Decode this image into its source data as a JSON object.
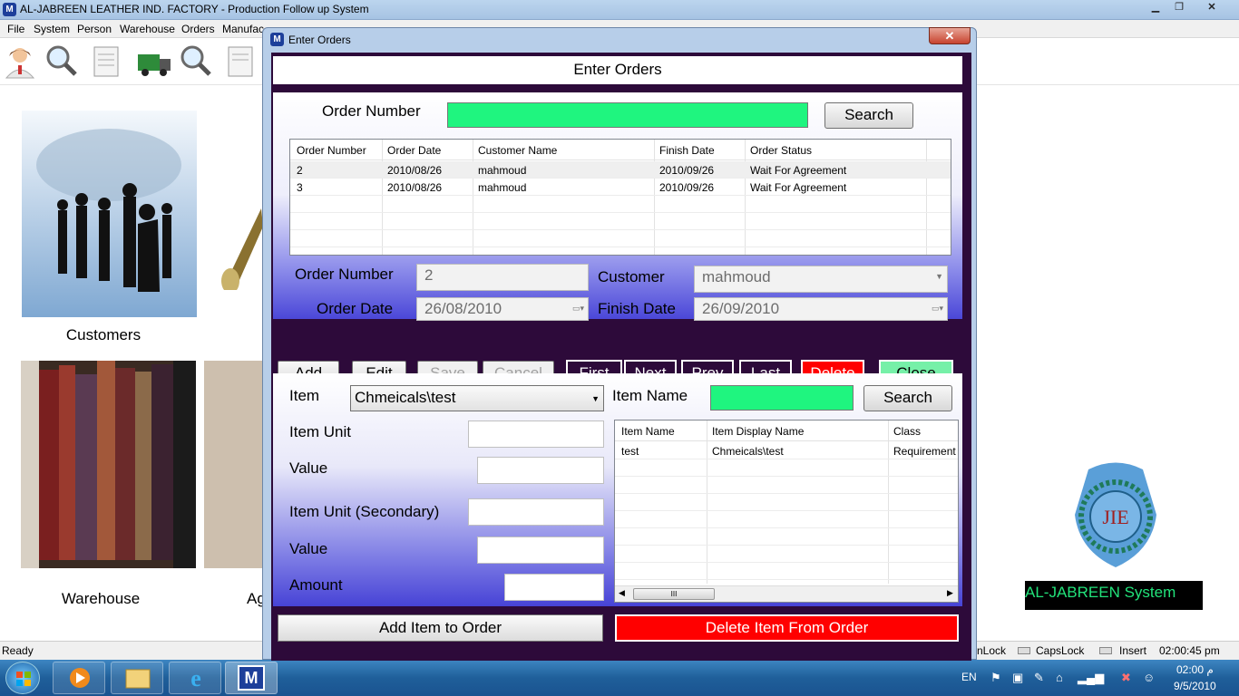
{
  "app": {
    "title": "AL-JABREEN LEATHER IND. FACTORY - Production Follow up System",
    "icon_letter": "M",
    "menu": [
      "File",
      "System",
      "Person",
      "Warehouse",
      "Orders",
      "Manufac"
    ]
  },
  "background": {
    "customers_caption": "Customers",
    "warehouse_caption": "Warehouse",
    "partial_caption": "Ag",
    "logo_text": "AL-JABREEN System"
  },
  "statusbar": {
    "ready": "Ready",
    "numlock": "nLock",
    "capslock": "CapsLock",
    "insert": "Insert",
    "time": "02:00:45 pm"
  },
  "taskbar": {
    "lang": "EN",
    "clock_time": "02:00 م",
    "clock_date": "9/5/2010",
    "m_letter": "M"
  },
  "dialog": {
    "window_title": "Enter Orders",
    "form_title": "Enter Orders",
    "close_glyph": "✕",
    "search_section": {
      "order_number_label": "Order Number",
      "search_button": "Search"
    },
    "orders_grid": {
      "columns": [
        "Order Number",
        "Order Date",
        "Customer Name",
        "Finish Date",
        "Order Status"
      ],
      "rows": [
        [
          "2",
          "2010/08/26",
          "mahmoud",
          "2010/09/26",
          "Wait For Agreement"
        ],
        [
          "3",
          "2010/08/26",
          "mahmoud",
          "2010/09/26",
          "Wait For Agreement"
        ]
      ]
    },
    "order_fields": {
      "order_number_label": "Order Number",
      "order_number_value": "2",
      "customer_label": "Customer",
      "customer_value": "mahmoud",
      "order_date_label": "Order Date",
      "order_date_value": "26/08/2010",
      "finish_date_label": "Finish Date",
      "finish_date_value": "26/09/2010"
    },
    "actions": {
      "add": "Add",
      "edit": "Edit",
      "save": "Save",
      "cancel": "Cancel",
      "first": "First",
      "next": "Next",
      "prev": "Prev",
      "last": "Last",
      "delete": "Delete",
      "close": "Close"
    },
    "item_section": {
      "item_label": "Item",
      "item_value": "Chmeicals\\test",
      "item_name_label": "Item Name",
      "search_button": "Search",
      "item_unit_label": "Item Unit",
      "value_label": "Value",
      "item_unit_secondary_label": "Item Unit (Secondary)",
      "value2_label": "Value",
      "amount_label": "Amount"
    },
    "items_grid": {
      "columns": [
        "Item Name",
        "Item Display Name",
        "Class"
      ],
      "rows": [
        [
          "test",
          "Chmeicals\\test",
          "Requirement"
        ]
      ],
      "scroll_grip": "III"
    },
    "bottom_buttons": {
      "add_item": "Add Item to Order",
      "delete_item": "Delete Item From Order"
    }
  },
  "colors": {
    "accent_green": "#1ff57f",
    "danger_red": "#ff0000",
    "form_dark": "#2d0a3a",
    "close_green": "#76f0a8"
  }
}
